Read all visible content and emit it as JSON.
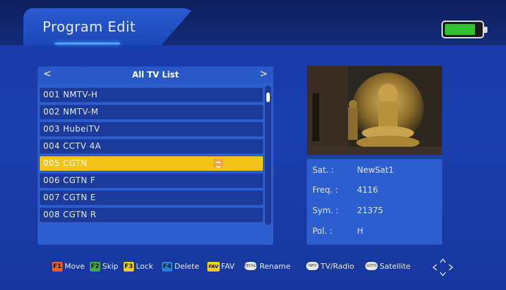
{
  "header": {
    "title": "Program Edit"
  },
  "battery": {
    "level": 0.85,
    "color": "#2ec22e"
  },
  "list": {
    "title": "All TV List",
    "prev_arrow": "<",
    "next_arrow": ">",
    "selected_index": 4,
    "rows": [
      {
        "label": "001 NMTV-H"
      },
      {
        "label": "002 NMTV-M"
      },
      {
        "label": "003 HubeiTV"
      },
      {
        "label": "004 CCTV 4A"
      },
      {
        "label": "005 CGTN"
      },
      {
        "label": "006 CGTN F"
      },
      {
        "label": "007 CGTN E"
      },
      {
        "label": "008 CGTN R"
      }
    ]
  },
  "info": {
    "sat_label": "Sat. :",
    "sat_value": "NewSat1",
    "freq_label": "Freq. :",
    "freq_value": "4116",
    "sym_label": "Sym. :",
    "sym_value": "21375",
    "pol_label": "Pol. :",
    "pol_value": "H"
  },
  "footer": {
    "f1_key": "F1",
    "f1_label": "Move",
    "f2_key": "F2",
    "f2_label": "Skip",
    "f3_key": "F3",
    "f3_label": "Lock",
    "f4_key": "F4",
    "f4_label": "Delete",
    "fav_key": "FAV",
    "fav_label": "FAV",
    "recall_key": "RECALL",
    "recall_label": "Rename",
    "info_key": "INFO",
    "info_label": "TV/Radio",
    "goto_key": "GOTO",
    "goto_label": "Satellite"
  },
  "colors": {
    "f1": "#e8622a",
    "f2": "#3fae3a",
    "f3": "#f2d21a",
    "f4": "#2a7fe0",
    "fav": "#f2d21a",
    "selected_row": "#f2c418",
    "panel": "#2d5ed0"
  }
}
